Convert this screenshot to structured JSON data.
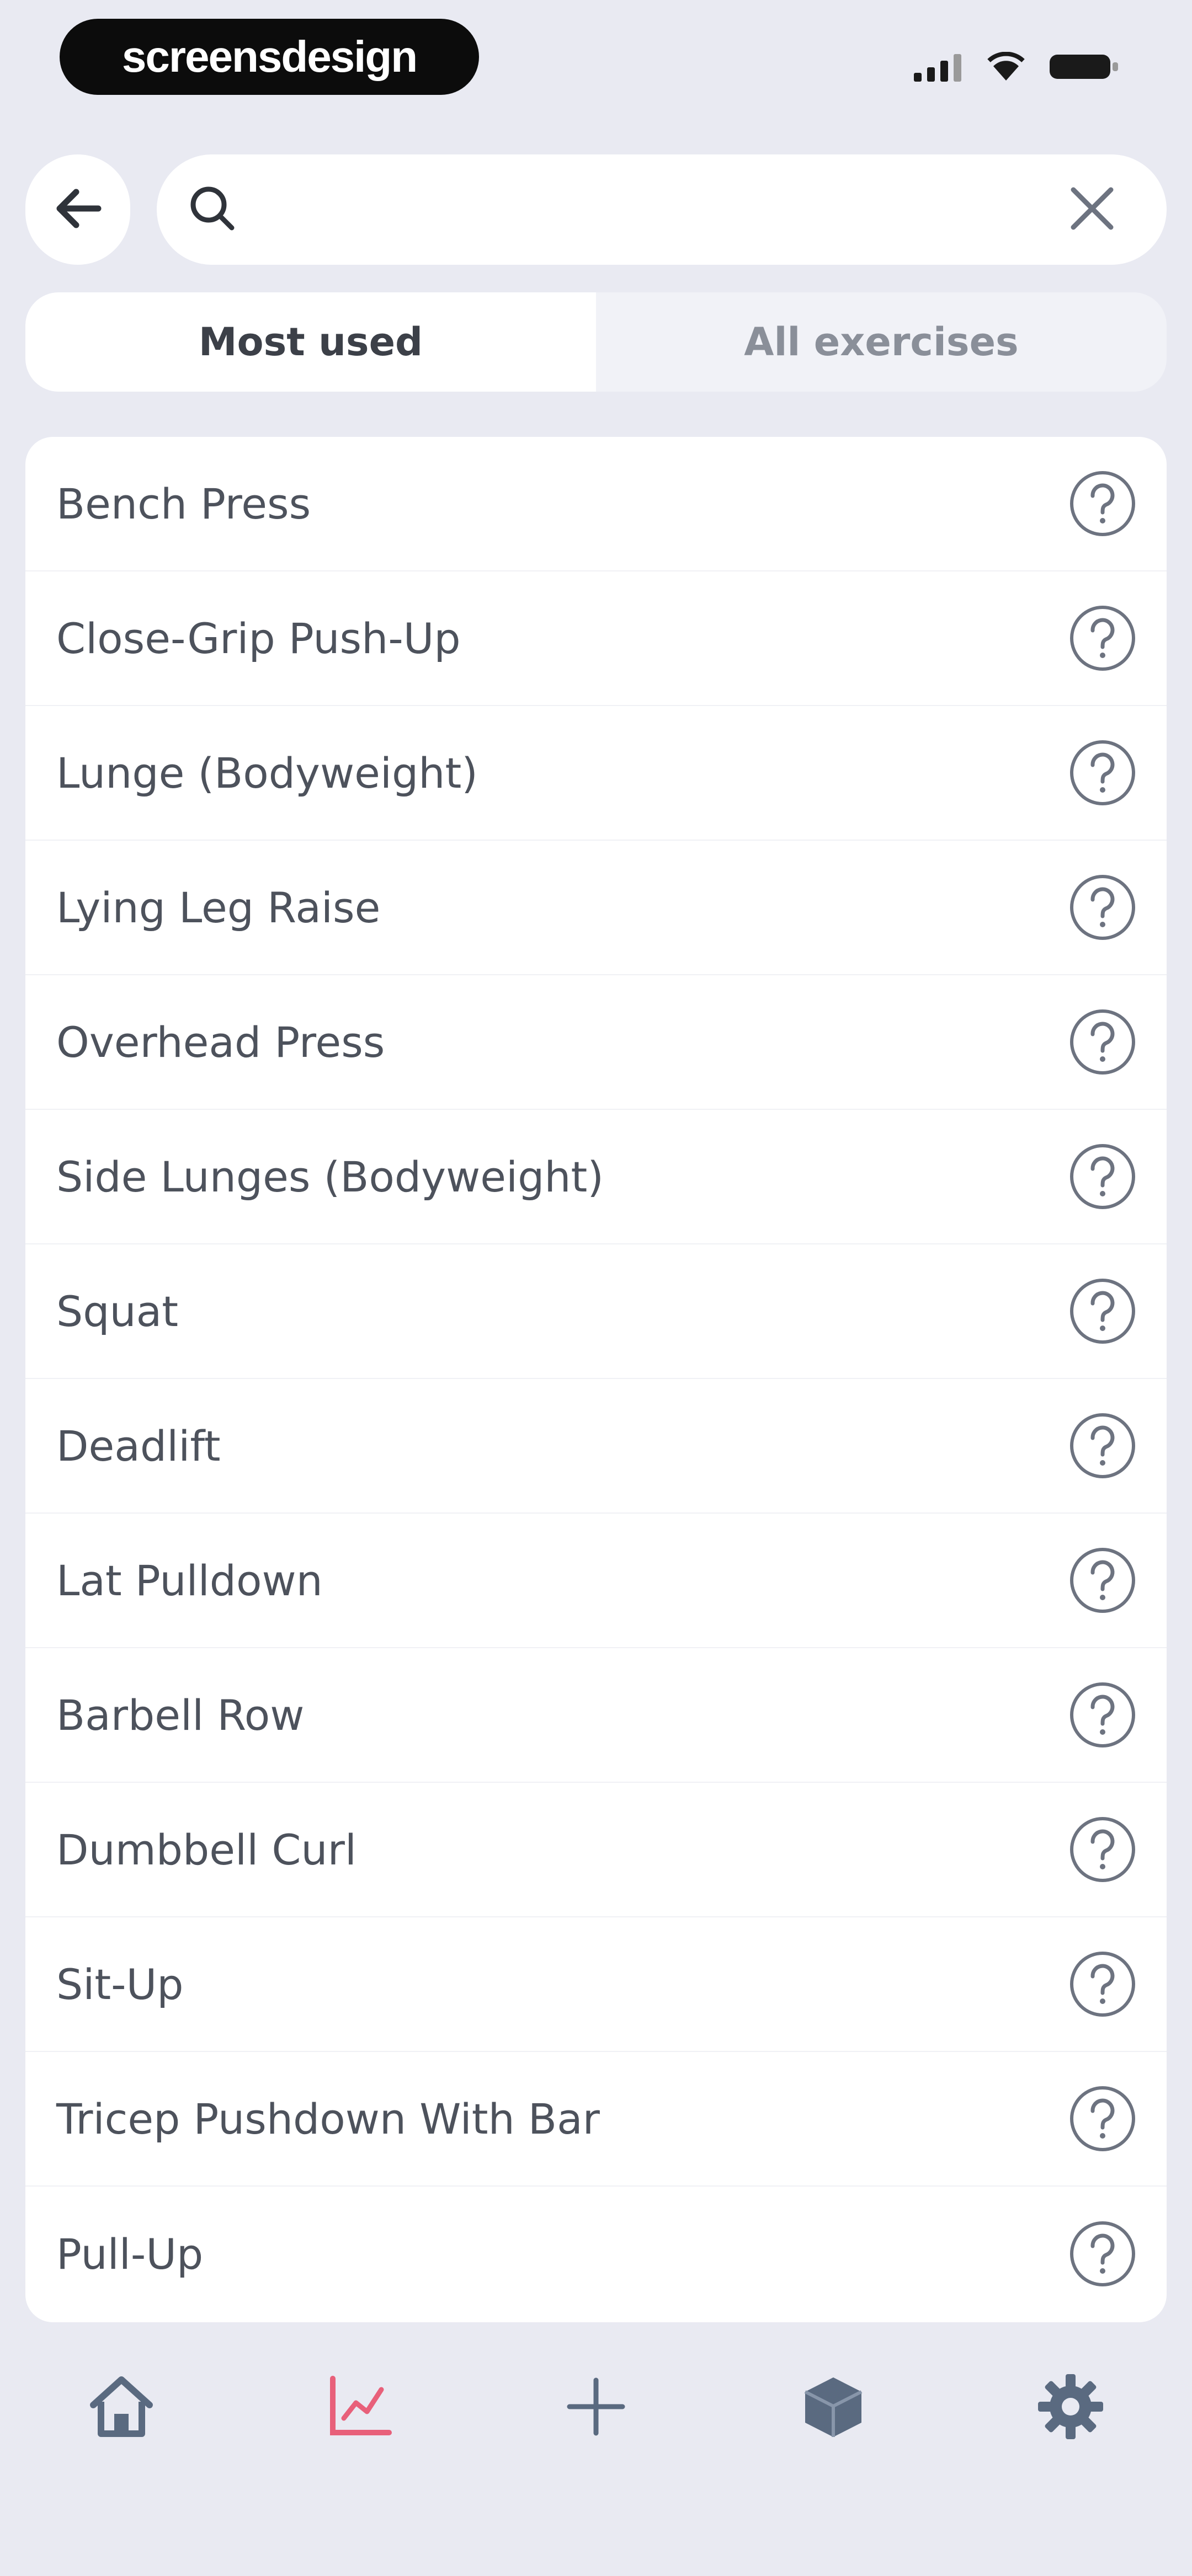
{
  "status_bar": {
    "brand": "screensdesign"
  },
  "search": {
    "value": "",
    "placeholder": ""
  },
  "tabs": [
    {
      "label": "Most used",
      "active": true
    },
    {
      "label": "All exercises",
      "active": false
    }
  ],
  "exercises": [
    {
      "label": "Bench Press"
    },
    {
      "label": "Close-Grip Push-Up"
    },
    {
      "label": "Lunge (Bodyweight)"
    },
    {
      "label": "Lying Leg Raise"
    },
    {
      "label": "Overhead Press"
    },
    {
      "label": "Side Lunges (Bodyweight)"
    },
    {
      "label": "Squat"
    },
    {
      "label": "Deadlift"
    },
    {
      "label": "Lat Pulldown"
    },
    {
      "label": "Barbell Row"
    },
    {
      "label": "Dumbbell Curl"
    },
    {
      "label": "Sit-Up"
    },
    {
      "label": "Tricep Pushdown With Bar"
    },
    {
      "label": "Pull-Up"
    }
  ],
  "icons": {
    "back": "arrow-left-icon",
    "search": "search-icon",
    "clear": "close-icon",
    "help": "question-circle-icon",
    "nav": [
      "home-icon",
      "chart-icon",
      "plus-icon",
      "cube-icon",
      "gear-icon"
    ]
  },
  "colors": {
    "background": "#e9eaf2",
    "surface": "#ffffff",
    "text": "#4d525c",
    "nav_icon": "#5a6a80",
    "nav_active": "#e8607a"
  }
}
